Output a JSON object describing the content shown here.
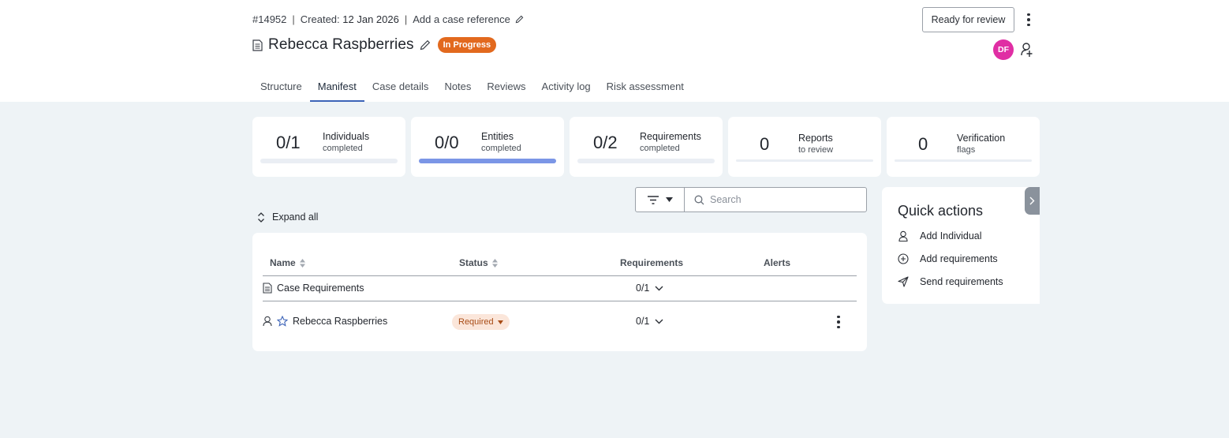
{
  "header": {
    "case_id": "#14952",
    "created_label": "Created:",
    "created_date": "12 Jan 2026",
    "reference_link": "Add a case reference",
    "case_title": "Rebecca Raspberries",
    "status_badge": "In Progress",
    "status_color": "#e2691e",
    "ready_button": "Ready for review",
    "avatar_initials": "DF",
    "avatar_color": "#e02ea4"
  },
  "tabs": [
    {
      "label": "Structure",
      "active": false
    },
    {
      "label": "Manifest",
      "active": true
    },
    {
      "label": "Case details",
      "active": false
    },
    {
      "label": "Notes",
      "active": false
    },
    {
      "label": "Reviews",
      "active": false
    },
    {
      "label": "Activity log",
      "active": false
    },
    {
      "label": "Risk assessment",
      "active": false
    }
  ],
  "stats": [
    {
      "value": "0/1",
      "label": "Individuals",
      "sub": "completed",
      "progress": 0
    },
    {
      "value": "0/0",
      "label": "Entities",
      "sub": "completed",
      "progress": 1
    },
    {
      "value": "0/2",
      "label": "Requirements",
      "sub": "completed",
      "progress": 0
    },
    {
      "value": "0",
      "label": "Reports",
      "sub": "to review",
      "progress": 0
    },
    {
      "value": "0",
      "label": "Verification",
      "sub": "flags",
      "progress": 0
    }
  ],
  "toolbar": {
    "search_placeholder": "Search",
    "expand_all": "Expand all"
  },
  "table": {
    "columns": {
      "name": "Name",
      "status": "Status",
      "requirements": "Requirements",
      "alerts": "Alerts"
    },
    "rows": [
      {
        "name": "Case Requirements",
        "status": "",
        "requirements": "0/1",
        "icon": "document-icon"
      },
      {
        "name": "Rebecca Raspberries",
        "status": "Required",
        "requirements": "0/1",
        "icon": "person-icon"
      }
    ]
  },
  "quick_actions": {
    "title": "Quick actions",
    "items": [
      {
        "label": "Add Individual",
        "icon": "person-icon"
      },
      {
        "label": "Add requirements",
        "icon": "plus-circle-icon"
      },
      {
        "label": "Send requirements",
        "icon": "send-icon"
      }
    ]
  },
  "colors": {
    "accent": "#3d64b8",
    "progress_fill": "#7b96e6",
    "required_bg": "#fbe6da",
    "background": "#eef3f6"
  }
}
